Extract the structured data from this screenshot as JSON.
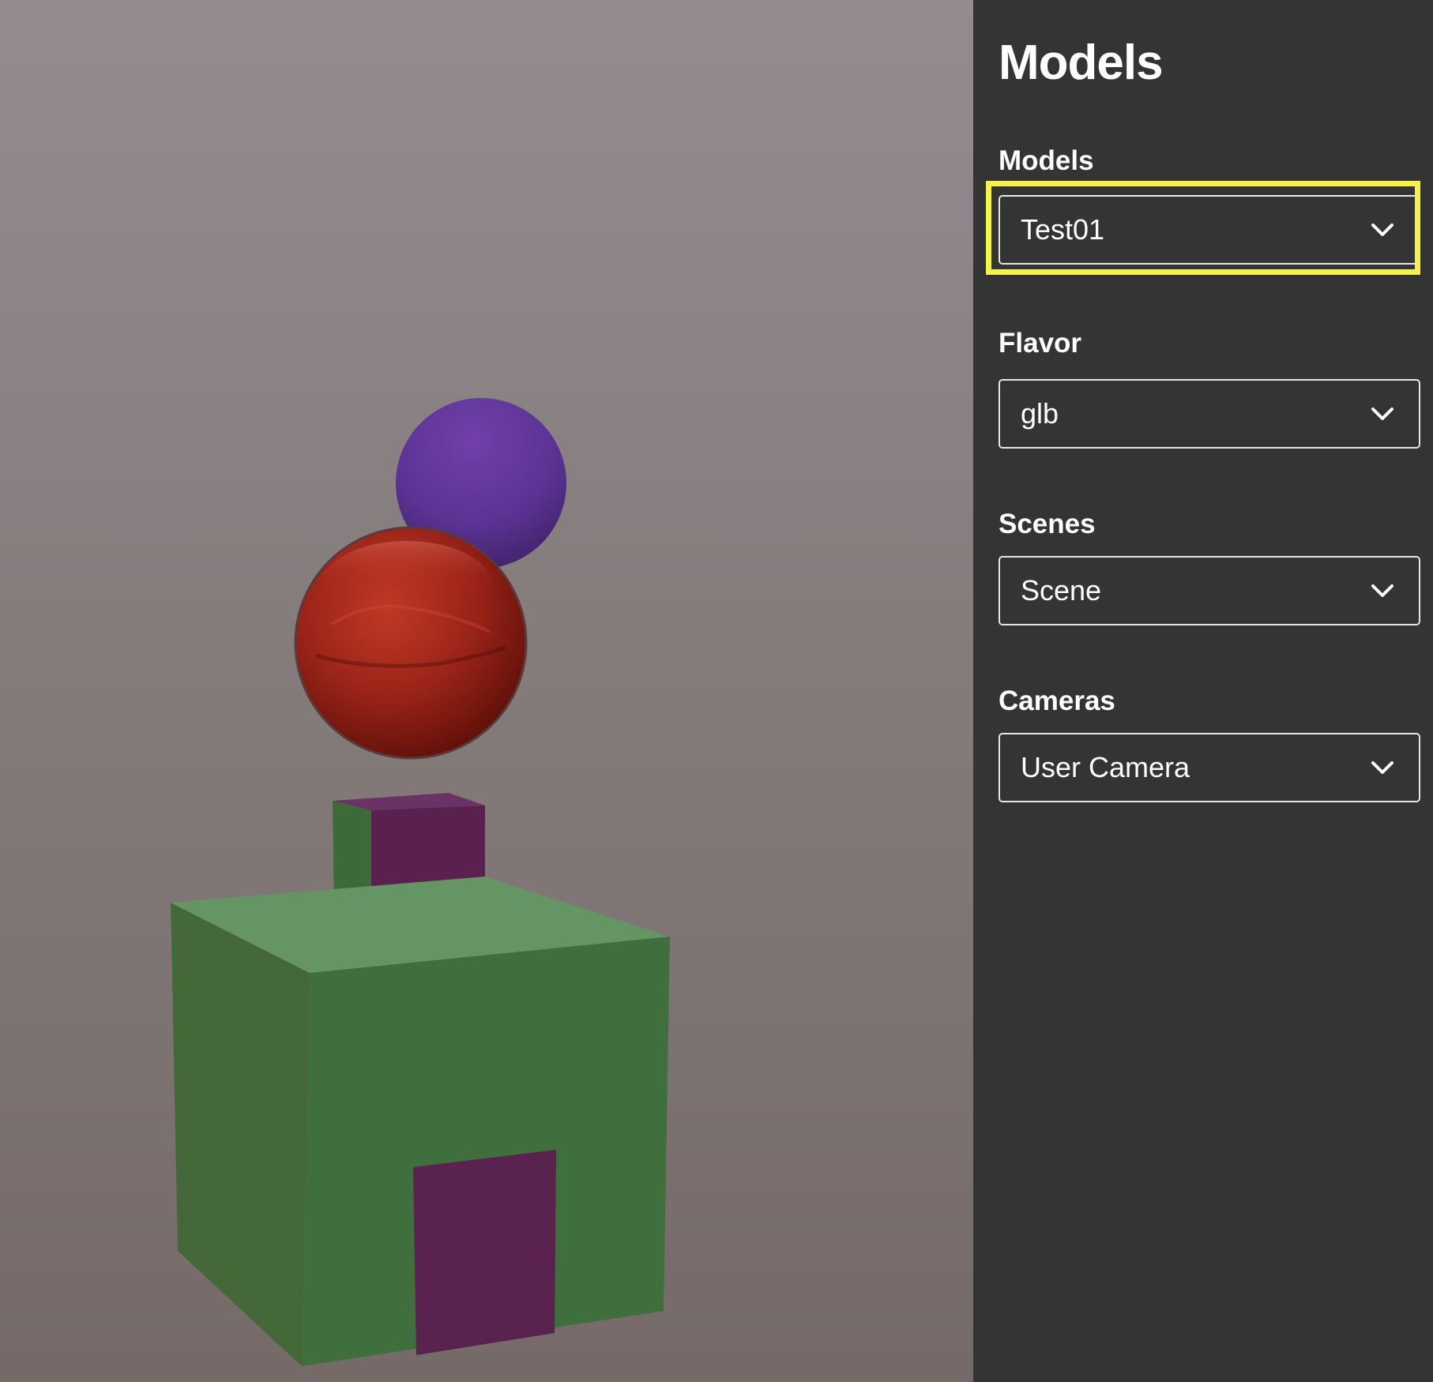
{
  "panel": {
    "title": "Models",
    "fields": [
      {
        "label": "Models",
        "value": "Test01"
      },
      {
        "label": "Flavor",
        "value": "glb"
      },
      {
        "label": "Scenes",
        "value": "Scene"
      },
      {
        "label": "Cameras",
        "value": "User Camera"
      }
    ]
  },
  "icons": {
    "dropdown": "chevron-down-icon"
  },
  "colors": {
    "panel_background": "#343434",
    "highlight": "#f5f24a",
    "cube_green": "#3f6e3d",
    "box_purple": "#5a224f",
    "sphere_purple": "#6a3a9e",
    "sphere_red": "#a0241a"
  }
}
